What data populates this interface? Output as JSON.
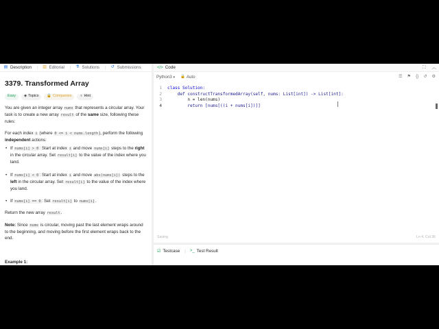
{
  "left_tabs": [
    {
      "icon": "description-icon",
      "label": "Description"
    },
    {
      "icon": "editorial-icon",
      "label": "Editorial"
    },
    {
      "icon": "flask-icon",
      "label": "Solutions"
    },
    {
      "icon": "history-icon",
      "label": "Submissions"
    }
  ],
  "problem": {
    "title": "3379. Transformed Array",
    "difficulty": "Easy",
    "topics_label": "Topics",
    "companies_label": "Companies",
    "hint_label": "Hint",
    "intro_a": "You are given an integer array ",
    "intro_code": "nums",
    "intro_b": " that represents a circular array. Your task is to create a new array ",
    "intro_code2": "result",
    "intro_c": " of the ",
    "intro_bold": "same",
    "intro_d": " size, following these rules:",
    "each_a": "For each index ",
    "each_code_i": "i",
    "each_b": " (where ",
    "each_code_range": "0 <= i < nums.length",
    "each_c": "), perform the following ",
    "each_bold": "independent",
    "each_d": " actions:",
    "rule1_a": "If ",
    "rule1_code": "nums[i] > 0",
    "rule1_b": ": Start at index ",
    "rule1_code_i": "i",
    "rule1_c": " and move ",
    "rule1_code_n": "nums[i]",
    "rule1_d": " steps to the ",
    "rule1_bold": "right",
    "rule1_e": " in the circular array. Set ",
    "rule1_code_r": "result[i]",
    "rule1_f": " to the value of the index where you land.",
    "rule2_a": "If ",
    "rule2_code": "nums[i] < 0",
    "rule2_b": ": Start at index ",
    "rule2_code_i": "i",
    "rule2_c": " and move ",
    "rule2_code_n": "abs(nums[i])",
    "rule2_d": " steps to the ",
    "rule2_bold": "left",
    "rule2_e": " in the circular array. Set ",
    "rule2_code_r": "result[i]",
    "rule2_f": " to the value of the index where you land.",
    "rule3_a": "If ",
    "rule3_code": "nums[i] == 0",
    "rule3_b": ": Set ",
    "rule3_code_r": "result[i]",
    "rule3_c": " to ",
    "rule3_code_n": "nums[i]",
    "rule3_d": ".",
    "return_a": "Return the new array ",
    "return_code": "result",
    "return_b": ".",
    "note_bold": "Note:",
    "note_a": " Since ",
    "note_code": "nums",
    "note_b": " is circular, moving past the last element wraps around to the beginning, and moving before the first element wraps back to the end.",
    "example_heading": "Example 1:"
  },
  "code_panel": {
    "title": "Code",
    "language": "Python3",
    "auto_label": "Auto",
    "status_left": "Saving",
    "status_right": "Ln 4, Col 36",
    "lines": [
      {
        "n": "1",
        "text": "class Solution:"
      },
      {
        "n": "2",
        "text": "    def constructTransformedArray(self, nums: List[int]) -> List[int]:"
      },
      {
        "n": "3",
        "text": "        n = len(nums)"
      },
      {
        "n": "4",
        "text": "        return [nums[((i + nums[i])]]"
      }
    ]
  },
  "bottom_tabs": {
    "testcase": "Testcase",
    "test_result": "Test Result"
  },
  "colors": {
    "accent_green": "#1ca35a",
    "easy": "#1ca35a",
    "company": "#e0a52f"
  }
}
